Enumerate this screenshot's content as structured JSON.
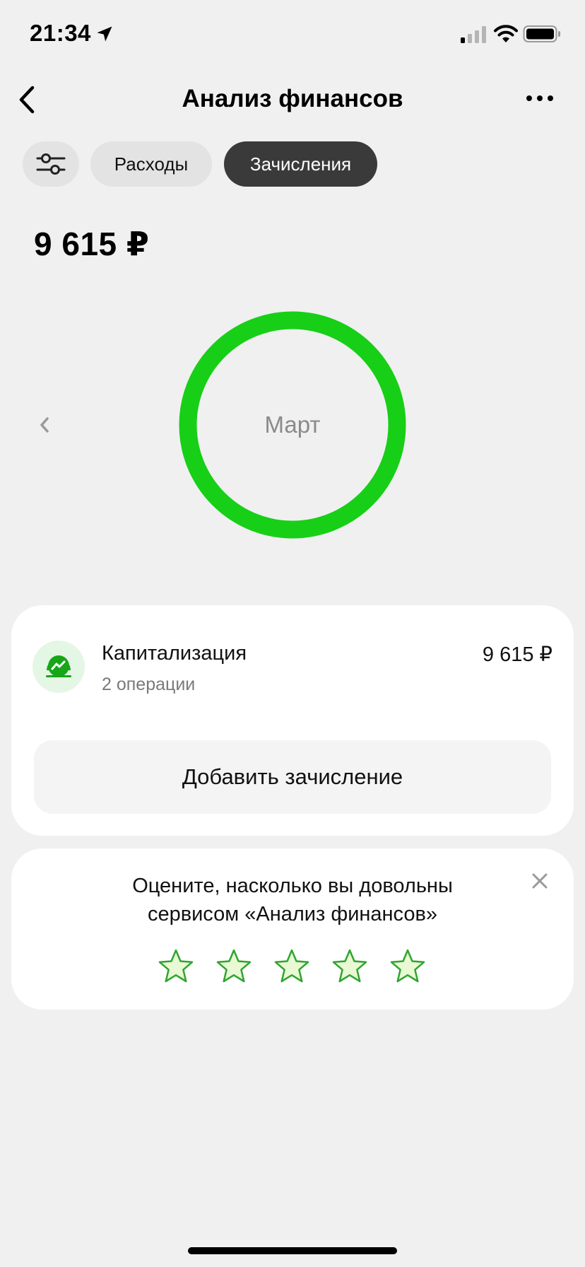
{
  "status_bar": {
    "time": "21:34",
    "icons": [
      "location-arrow-icon",
      "cellular-signal-icon",
      "wifi-icon",
      "battery-icon"
    ]
  },
  "header": {
    "title": "Анализ финансов",
    "back_icon": "chevron-left-icon",
    "more_icon": "more-horizontal-icon"
  },
  "tabs": {
    "filter_icon": "sliders-icon",
    "expenses": "Расходы",
    "income": "Зачисления",
    "active": "income"
  },
  "summary": {
    "total": "9 615 ₽"
  },
  "donut": {
    "label": "Март",
    "color": "#17cf17",
    "share": 1.0
  },
  "categories": [
    {
      "name": "Капитализация",
      "count": "2 операции",
      "amount": "9 615 ₽",
      "icon": "trend-up-icon"
    }
  ],
  "add_button": {
    "label": "Добавить зачисление"
  },
  "rating": {
    "text": "Оцените, насколько вы довольны сервисом «Анализ финансов»",
    "stars": 5,
    "star_color": "#e8f9d4",
    "star_stroke": "#2fa52f"
  },
  "colors": {
    "accent": "#17cf17",
    "background": "#f0f0f0",
    "active_tab": "#3a3a3a"
  }
}
